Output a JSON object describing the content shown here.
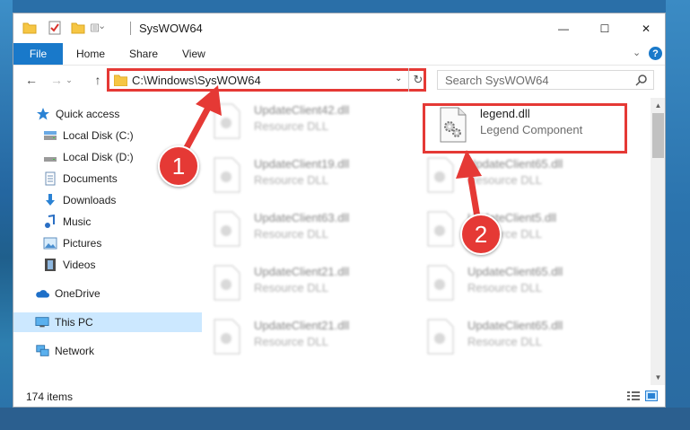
{
  "window": {
    "title": "SysWOW64",
    "controls": {
      "minimize": "—",
      "maximize": "☐",
      "close": "✕"
    }
  },
  "ribbon": {
    "tabs": [
      "File",
      "Home",
      "Share",
      "View"
    ],
    "expand": "⌄",
    "help": "?"
  },
  "navigation": {
    "back": "←",
    "forward": "→",
    "recent": "⌄",
    "up": "↑",
    "address": "C:\\Windows\\SysWOW64",
    "address_dropdown": "⌄",
    "refresh": "↻",
    "search_placeholder": "Search SysWOW64"
  },
  "sidebar": {
    "items": [
      {
        "label": "Quick access",
        "icon": "star-icon",
        "pinned": false
      },
      {
        "label": "Local Disk (C:)",
        "icon": "drive-icon",
        "pinned": true
      },
      {
        "label": "Local Disk (D:)",
        "icon": "drive-icon",
        "pinned": false
      },
      {
        "label": "Documents",
        "icon": "documents-icon",
        "pinned": true
      },
      {
        "label": "Downloads",
        "icon": "download-icon",
        "pinned": true
      },
      {
        "label": "Music",
        "icon": "music-icon",
        "pinned": true
      },
      {
        "label": "Pictures",
        "icon": "pictures-icon",
        "pinned": true
      },
      {
        "label": "Videos",
        "icon": "video-icon",
        "pinned": true
      },
      {
        "label": "OneDrive",
        "icon": "cloud-icon",
        "pinned": false
      },
      {
        "label": "This PC",
        "icon": "computer-icon",
        "pinned": false,
        "selected": true
      },
      {
        "label": "Network",
        "icon": "network-icon",
        "pinned": false
      }
    ]
  },
  "files": {
    "left_column": [
      {
        "name": "UpdateClient42.dll",
        "type": "Resource DLL"
      },
      {
        "name": "UpdateClient19.dll",
        "type": "Resource DLL"
      },
      {
        "name": "UpdateClient63.dll",
        "type": "Resource DLL"
      },
      {
        "name": "UpdateClient21.dll",
        "type": "Resource DLL"
      },
      {
        "name": "UpdateClient21.dll",
        "type": "Resource DLL"
      }
    ],
    "right_column": [
      {
        "name": "legend.dll",
        "type": "Legend Component",
        "highlighted": true
      },
      {
        "name": "UpdateClient65.dll",
        "type": "Resource DLL"
      },
      {
        "name": "UpdateClient5.dll",
        "type": "Resource DLL"
      },
      {
        "name": "UpdateClient65.dll",
        "type": "Resource DLL"
      },
      {
        "name": "UpdateClient65.dll",
        "type": "Resource DLL"
      }
    ]
  },
  "status": {
    "item_count": "174 items"
  },
  "annotations": {
    "step1": "1",
    "step2": "2",
    "accent_color": "#e53935"
  },
  "colors": {
    "file_tab": "#1979ca",
    "selection": "#cce8ff"
  }
}
